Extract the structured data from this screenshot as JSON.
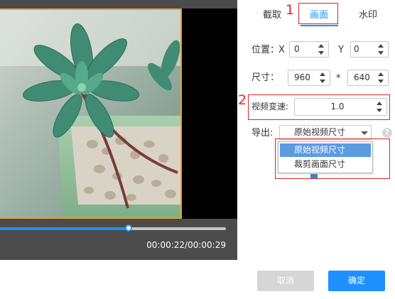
{
  "tabs": [
    {
      "label": "截取",
      "active": false
    },
    {
      "label": "画面",
      "active": true
    },
    {
      "label": "水印",
      "active": false
    }
  ],
  "annotations": [
    "1",
    "2"
  ],
  "player": {
    "time": "00:00:22/00:00:29",
    "progress": 0.57
  },
  "form": {
    "position_label": "位置：",
    "x_label": "X",
    "x_value": "0",
    "y_label": "Y",
    "y_value": "0",
    "size_label": "尺寸：",
    "width_value": "960",
    "size_separator": "*",
    "height_value": "640",
    "speed_label": "视频变速:",
    "speed_value": "1.0",
    "export_label": "导出:",
    "export_value": "原始视频尺寸",
    "help_symbol": "?",
    "export_options": [
      "原始视频尺寸",
      "裁剪画面尺寸"
    ]
  },
  "buttons": {
    "cancel": "取消",
    "ok": "确定"
  },
  "colors": {
    "accent": "#1e90ff",
    "crop_border": "#f0a22a",
    "annotation": "#e02424",
    "dropdown_highlight": "#5b9be0"
  }
}
